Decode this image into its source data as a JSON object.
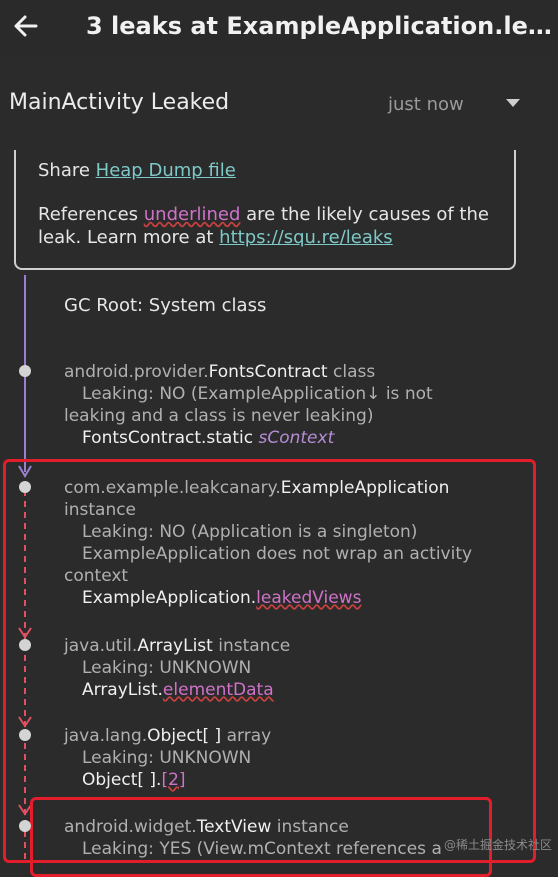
{
  "appbar": {
    "title": "3 leaks at ExampleApplication.le…",
    "back_icon": "arrow-left-icon"
  },
  "leak_header": {
    "title": "MainActivity Leaked",
    "time": "just now",
    "dropdown_icon": "triangle-down-icon"
  },
  "info": {
    "share_prefix": "Share ",
    "share_link": "Heap Dump file",
    "refs_prefix": "References ",
    "refs_underlined": "underlined",
    "refs_suffix": " are the likely causes of the",
    "learn_prefix": "leak. Learn more at ",
    "learn_link": "https://squ.re/leaks"
  },
  "gc_root": "GC Root: System class",
  "nodes": [
    {
      "pkg": "android.provider.",
      "cls": "FontsContract",
      "kind": " class",
      "leak1": "Leaking: NO (ExampleApplication↓ is not",
      "leak2": "leaking and a class is never leaking)",
      "ref_cls": "FontsContract.static ",
      "ref_field": "sContext"
    },
    {
      "pkg": "com.example.leakcanary.",
      "cls": "ExampleApplication",
      "kind2": "instance",
      "leak1": "Leaking: NO (Application is a singleton)",
      "leak2": "ExampleApplication does not wrap an activity",
      "leak3": "context",
      "ref_cls": "ExampleApplication.",
      "ref_field": "leakedViews"
    },
    {
      "pkg": "java.util.",
      "cls": "ArrayList",
      "kind": " instance",
      "leak1": "Leaking: UNKNOWN",
      "ref_cls": "ArrayList.",
      "ref_field": "elementData"
    },
    {
      "pkg": "java.lang.",
      "cls": "Object[ ]",
      "kind": " array",
      "leak1": "Leaking: UNKNOWN",
      "ref_cls": "Object[ ].",
      "ref_field": "[2]"
    },
    {
      "pkg": "android.widget.",
      "cls": "TextView",
      "kind": " instance",
      "leak1": "Leaking: YES (View.mContext references a"
    }
  ],
  "watermark": "@稀土掘金技术社区",
  "colors": {
    "background": "#2b2b2b",
    "link": "#7ec8c8",
    "underlined": "#cf72c9",
    "highlight_box": "#e21d2c",
    "trail_solid": "#9b7fd0",
    "trail_dashed": "#e05060"
  }
}
